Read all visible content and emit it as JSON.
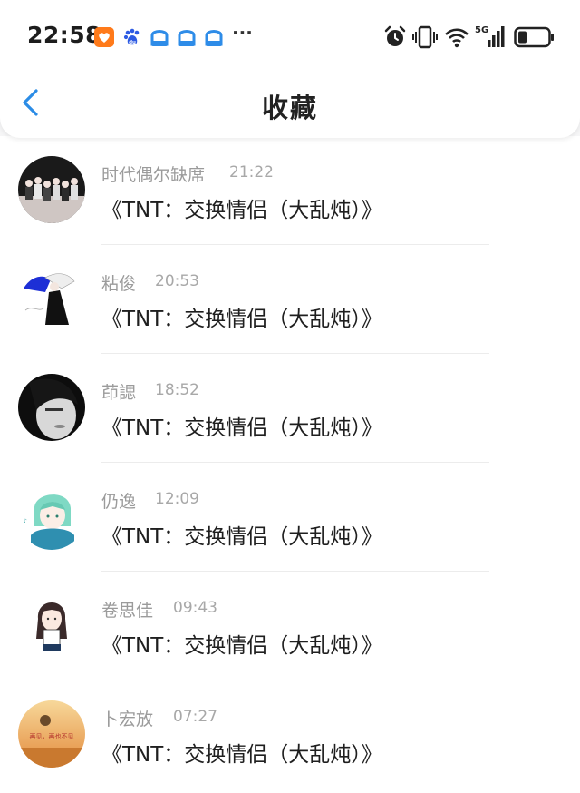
{
  "status_bar": {
    "time": "22:58",
    "more": "···",
    "network": "5G"
  },
  "nav": {
    "title": "收藏"
  },
  "favorites": [
    {
      "name": "时代偶尔缺席",
      "time": "21:22",
      "title": "《TNT：交换情侣（大乱炖）》"
    },
    {
      "name": "粘俊",
      "time": "20:53",
      "title": "《TNT：交换情侣（大乱炖）》"
    },
    {
      "name": "茚諰",
      "time": "18:52",
      "title": "《TNT：交换情侣（大乱炖）》"
    },
    {
      "name": "仍逸",
      "time": "12:09",
      "title": "《TNT：交换情侣（大乱炖）》"
    },
    {
      "name": "卷思佳",
      "time": "09:43",
      "title": "《TNT：交换情侣（大乱炖）》"
    },
    {
      "name": "卜宏放",
      "time": "07:27",
      "title": "《TNT：交换情侣（大乱炖）》",
      "avatar_text": "再见，再也不见"
    }
  ],
  "colors": {
    "accent": "#2b8ce6",
    "name_gray": "#9b9b9b",
    "title_black": "#1f1f1f"
  }
}
